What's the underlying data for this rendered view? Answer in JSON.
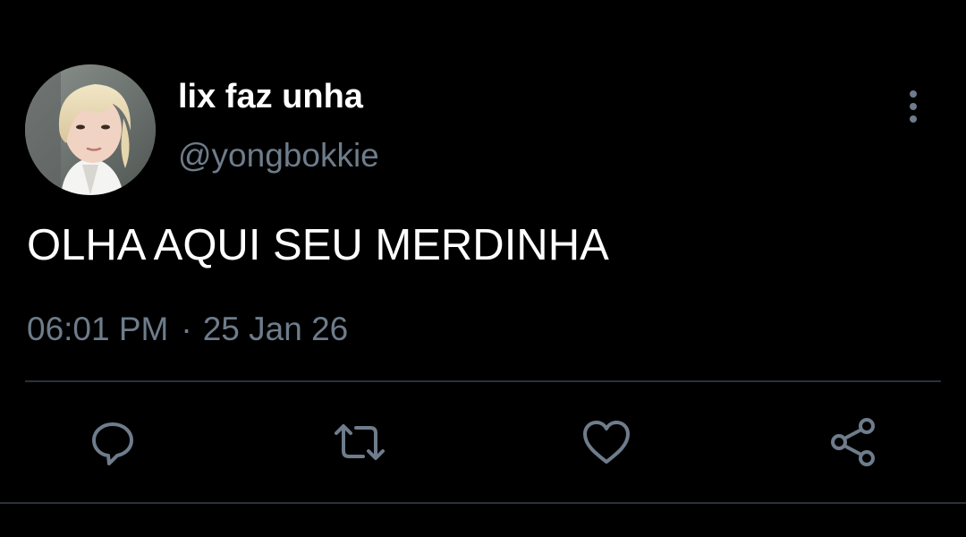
{
  "tweet": {
    "display_name": "lix faz unha",
    "handle": "@yongbokkie",
    "text": "OLHA AQUI SEU MERDINHA",
    "time": "06:01 PM",
    "separator": "·",
    "date": "25 Jan 26"
  },
  "actions": {
    "reply_icon": "reply-bubble-icon",
    "retweet_icon": "retweet-icon",
    "like_icon": "heart-icon",
    "share_icon": "share-icon"
  },
  "colors": {
    "background": "#000000",
    "primary_text": "#ffffff",
    "secondary_text": "#6e7c8b",
    "divider": "#2b3138"
  }
}
